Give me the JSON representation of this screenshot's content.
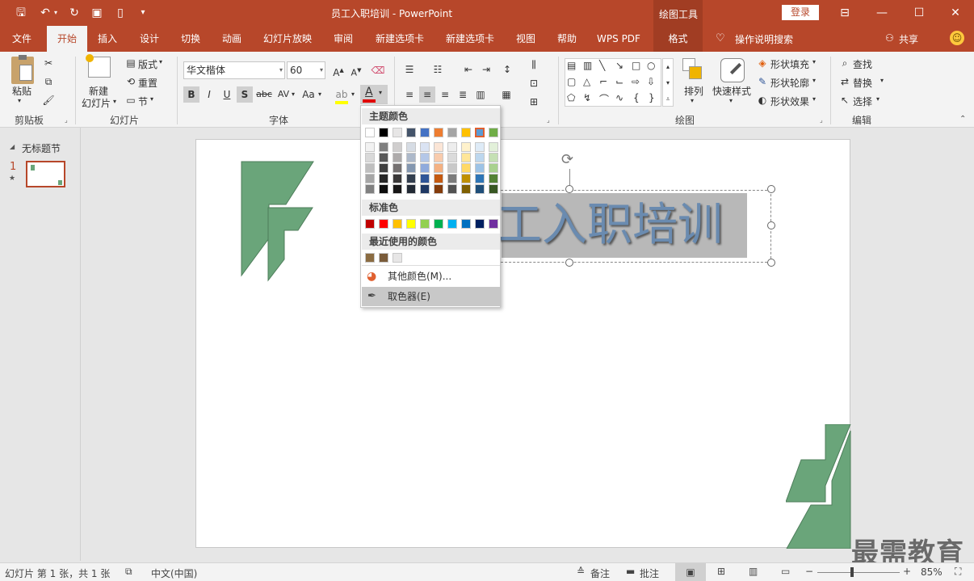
{
  "titlebar": {
    "title": "员工入职培训  -  PowerPoint",
    "context_label": "绘图工具",
    "login": "登录"
  },
  "tabs": [
    "文件",
    "开始",
    "插入",
    "设计",
    "切换",
    "动画",
    "幻灯片放映",
    "审阅",
    "新建选项卡",
    "新建选项卡",
    "视图",
    "帮助",
    "WPS PDF",
    "格式"
  ],
  "search": "操作说明搜索",
  "share": "共享",
  "ribbon": {
    "clipboard": {
      "paste": "粘贴",
      "label": "剪贴板"
    },
    "slides": {
      "new_slide_1": "新建",
      "new_slide_2": "幻灯片",
      "layout": "版式",
      "reset": "重置",
      "section": "节",
      "label": "幻灯片"
    },
    "font": {
      "name": "华文楷体",
      "size": "60",
      "bold": "B",
      "italic": "I",
      "underline": "U",
      "shadow": "S",
      "strike": "abc",
      "spacing": "AV",
      "case": "Aa",
      "label": "字体"
    },
    "drawing": {
      "arrange": "排列",
      "quick_styles": "快速样式",
      "fill": "形状填充",
      "outline": "形状轮廓",
      "effects": "形状效果",
      "label": "绘图"
    },
    "editing": {
      "find": "查找",
      "replace": "替换",
      "select": "选择",
      "label": "编辑"
    }
  },
  "thumbs": {
    "section": "无标题节",
    "slide_num": "1"
  },
  "slide": {
    "title": "员工入职培训",
    "visible_title": "工入职培训"
  },
  "color_menu": {
    "theme_header": "主题颜色",
    "standard_header": "标准色",
    "recent_header": "最近使用的颜色",
    "more_colors": "其他颜色(M)...",
    "eyedropper": "取色器(E)",
    "theme_top": [
      "#ffffff",
      "#000000",
      "#e7e6e6",
      "#44546a",
      "#4472c4",
      "#ed7d31",
      "#a5a5a5",
      "#ffc000",
      "#5b9bd5",
      "#70ad47"
    ],
    "theme_shades": [
      [
        "#f2f2f2",
        "#d9d9d9",
        "#bfbfbf",
        "#a6a6a6",
        "#808080"
      ],
      [
        "#7f7f7f",
        "#595959",
        "#404040",
        "#262626",
        "#0d0d0d"
      ],
      [
        "#d0cece",
        "#aeabab",
        "#757171",
        "#3a3838",
        "#171616"
      ],
      [
        "#d6dce4",
        "#adb9ca",
        "#8497b0",
        "#333f4f",
        "#222a35"
      ],
      [
        "#dae3f3",
        "#b4c7e7",
        "#8faadc",
        "#2f5597",
        "#1f3864"
      ],
      [
        "#fbe5d6",
        "#f8cbad",
        "#f4b183",
        "#c55a11",
        "#843c0c"
      ],
      [
        "#ededed",
        "#dbdbdb",
        "#c9c9c9",
        "#7b7b7b",
        "#525252"
      ],
      [
        "#fff2cc",
        "#ffe699",
        "#ffd966",
        "#bf9000",
        "#7f6000"
      ],
      [
        "#deebf7",
        "#bdd7ee",
        "#9dc3e6",
        "#2e75b6",
        "#1f4e79"
      ],
      [
        "#e2f0d9",
        "#c5e0b4",
        "#a9d18e",
        "#548235",
        "#385723"
      ]
    ],
    "standard": [
      "#c00000",
      "#ff0000",
      "#ffc000",
      "#ffff00",
      "#92d050",
      "#00b050",
      "#00b0f0",
      "#0070c0",
      "#002060",
      "#7030a0"
    ],
    "recent": [
      "#8b6c42",
      "#7a5c3a",
      "#e7e6e6"
    ]
  },
  "status": {
    "slide_info": "幻灯片 第 1 张，共 1 张",
    "language": "中文(中国)",
    "notes": "备注",
    "comments": "批注",
    "zoom": "85%"
  },
  "watermark": "最需教育",
  "colors": {
    "accent": "#b7472a",
    "shape_green": "#6aa57a",
    "title_bg": "#b8b8b8",
    "title_text": "#6a8bb0"
  }
}
